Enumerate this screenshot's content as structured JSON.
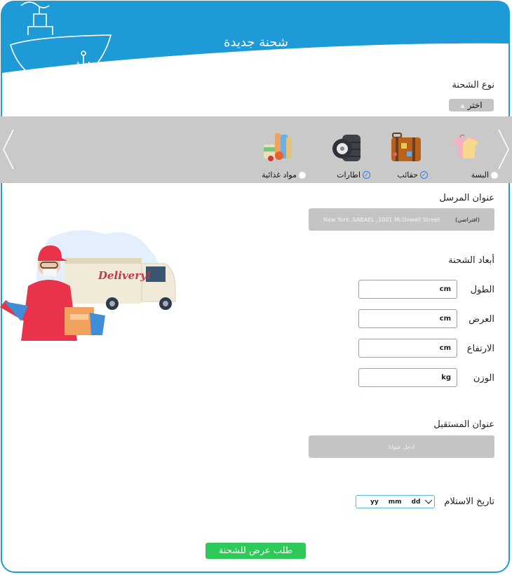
{
  "header": {
    "title": "شحنة جديدة"
  },
  "shipment_type": {
    "label": "نوع الشحنة",
    "dropdown_label": "اختر",
    "categories": [
      {
        "label": "البسة",
        "icon": "clothes-icon",
        "state": "unselected"
      },
      {
        "label": "حقائب",
        "icon": "luggage-icon",
        "state": "checked"
      },
      {
        "label": "اطارات",
        "icon": "tires-icon",
        "state": "checked"
      },
      {
        "label": "مواد غذائية",
        "icon": "groceries-icon",
        "state": "unselected"
      }
    ]
  },
  "sender": {
    "label": "عنوان المرسل",
    "address_tag": "(افتراضي)",
    "address": "New York ,SABAEL ,1001 McDowell Street"
  },
  "dimensions": {
    "label": "أبعاد الشحنة",
    "length": {
      "label": "الطول",
      "unit": "cm"
    },
    "width": {
      "label": "العرض",
      "unit": "cm"
    },
    "height": {
      "label": "الارتفاع",
      "unit": "cm"
    },
    "weight": {
      "label": "الوزن",
      "unit": "kg"
    }
  },
  "receiver": {
    "label": "عنوان المستقبل",
    "placeholder": "ادخل عنوانا"
  },
  "receive_date": {
    "label": "تاريخ الاستلام",
    "yy": "yy",
    "mm": "mm",
    "dd": "dd"
  },
  "submit_label": "طلب عرض للشحنة",
  "illustration": {
    "truck_text": "Delivery!"
  },
  "colors": {
    "brand": "#1e9ad6",
    "submit": "#2fc95a",
    "box": "#c4c4c4"
  }
}
